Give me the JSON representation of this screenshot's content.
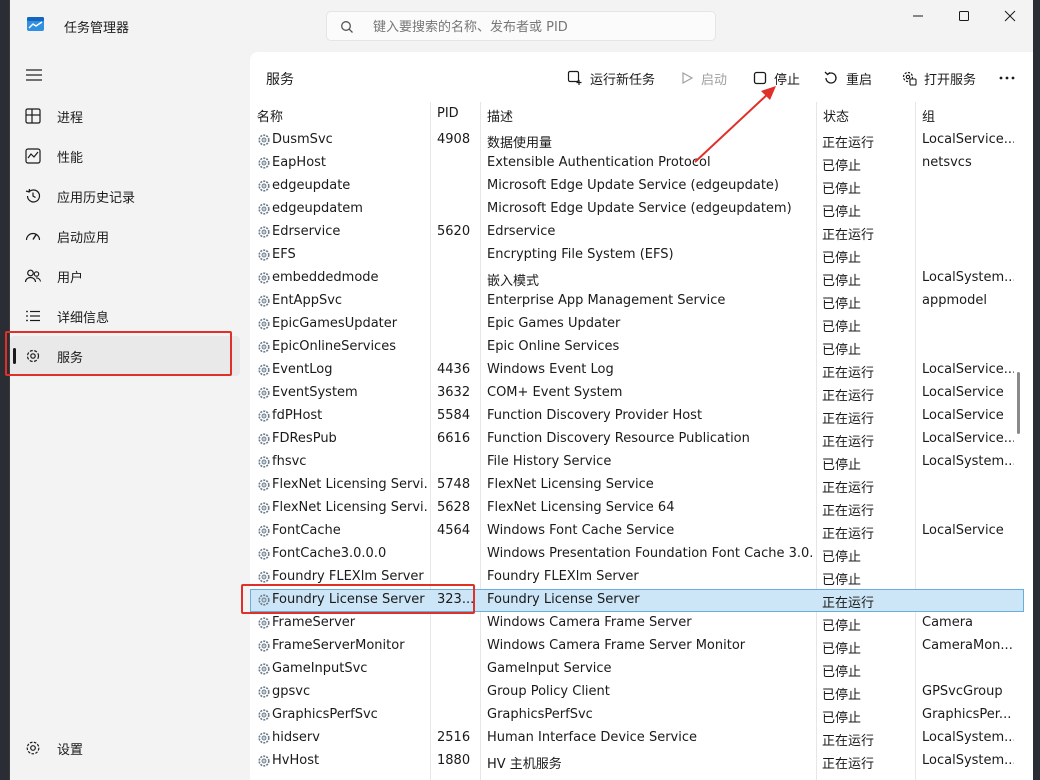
{
  "app": {
    "title": "任务管理器",
    "search_placeholder": "键入要搜索的名称、发布者或 PID"
  },
  "window_controls": {
    "minimize_icon": "minimize-icon",
    "maximize_icon": "maximize-icon",
    "close_icon": "close-icon"
  },
  "sidebar": {
    "items": [
      {
        "label": "进程",
        "icon": "processes-icon"
      },
      {
        "label": "性能",
        "icon": "performance-icon"
      },
      {
        "label": "应用历史记录",
        "icon": "history-icon"
      },
      {
        "label": "启动应用",
        "icon": "startup-icon"
      },
      {
        "label": "用户",
        "icon": "users-icon"
      },
      {
        "label": "详细信息",
        "icon": "details-icon"
      },
      {
        "label": "服务",
        "icon": "services-icon",
        "active": true
      }
    ],
    "settings_label": "设置"
  },
  "main": {
    "title": "服务",
    "toolbar": {
      "run_new_task": "运行新任务",
      "start": "启动",
      "stop": "停止",
      "restart": "重启",
      "open_services": "打开服务",
      "more_icon": "more-icon"
    }
  },
  "table": {
    "columns": [
      "名称",
      "PID",
      "描述",
      "状态",
      "组"
    ],
    "rows": [
      {
        "name": "DusmSvc",
        "pid": "4908",
        "desc": "数据使用量",
        "status": "正在运行",
        "group": "LocalService..."
      },
      {
        "name": "EapHost",
        "pid": "",
        "desc": "Extensible Authentication Protocol",
        "status": "已停止",
        "group": "netsvcs"
      },
      {
        "name": "edgeupdate",
        "pid": "",
        "desc": "Microsoft Edge Update Service (edgeupdate)",
        "status": "已停止",
        "group": ""
      },
      {
        "name": "edgeupdatem",
        "pid": "",
        "desc": "Microsoft Edge Update Service (edgeupdatem)",
        "status": "已停止",
        "group": ""
      },
      {
        "name": "Edrservice",
        "pid": "5620",
        "desc": "Edrservice",
        "status": "正在运行",
        "group": ""
      },
      {
        "name": "EFS",
        "pid": "",
        "desc": "Encrypting File System (EFS)",
        "status": "已停止",
        "group": ""
      },
      {
        "name": "embeddedmode",
        "pid": "",
        "desc": "嵌入模式",
        "status": "已停止",
        "group": "LocalSystem..."
      },
      {
        "name": "EntAppSvc",
        "pid": "",
        "desc": "Enterprise App Management Service",
        "status": "已停止",
        "group": "appmodel"
      },
      {
        "name": "EpicGamesUpdater",
        "pid": "",
        "desc": "Epic Games Updater",
        "status": "已停止",
        "group": ""
      },
      {
        "name": "EpicOnlineServices",
        "pid": "",
        "desc": "Epic Online Services",
        "status": "已停止",
        "group": ""
      },
      {
        "name": "EventLog",
        "pid": "4436",
        "desc": "Windows Event Log",
        "status": "正在运行",
        "group": "LocalService..."
      },
      {
        "name": "EventSystem",
        "pid": "3632",
        "desc": "COM+ Event System",
        "status": "正在运行",
        "group": "LocalService"
      },
      {
        "name": "fdPHost",
        "pid": "5584",
        "desc": "Function Discovery Provider Host",
        "status": "正在运行",
        "group": "LocalService"
      },
      {
        "name": "FDResPub",
        "pid": "6616",
        "desc": "Function Discovery Resource Publication",
        "status": "正在运行",
        "group": "LocalService..."
      },
      {
        "name": "fhsvc",
        "pid": "",
        "desc": "File History Service",
        "status": "已停止",
        "group": "LocalSystem..."
      },
      {
        "name": "FlexNet Licensing Servi...",
        "pid": "5748",
        "desc": "FlexNet Licensing Service",
        "status": "正在运行",
        "group": ""
      },
      {
        "name": "FlexNet Licensing Servi...",
        "pid": "5628",
        "desc": "FlexNet Licensing Service 64",
        "status": "正在运行",
        "group": ""
      },
      {
        "name": "FontCache",
        "pid": "4564",
        "desc": "Windows Font Cache Service",
        "status": "正在运行",
        "group": "LocalService"
      },
      {
        "name": "FontCache3.0.0.0",
        "pid": "",
        "desc": "Windows Presentation Foundation Font Cache 3.0....",
        "status": "已停止",
        "group": ""
      },
      {
        "name": "Foundry FLEXlm Server",
        "pid": "",
        "desc": "Foundry FLEXlm Server",
        "status": "已停止",
        "group": ""
      },
      {
        "name": "Foundry License Server",
        "pid": "323...",
        "desc": "Foundry License Server",
        "status": "正在运行",
        "group": "",
        "selected": true
      },
      {
        "name": "FrameServer",
        "pid": "",
        "desc": "Windows Camera Frame Server",
        "status": "已停止",
        "group": "Camera"
      },
      {
        "name": "FrameServerMonitor",
        "pid": "",
        "desc": "Windows Camera Frame Server Monitor",
        "status": "已停止",
        "group": "CameraMon..."
      },
      {
        "name": "GameInputSvc",
        "pid": "",
        "desc": "GameInput Service",
        "status": "已停止",
        "group": ""
      },
      {
        "name": "gpsvc",
        "pid": "",
        "desc": "Group Policy Client",
        "status": "已停止",
        "group": "GPSvcGroup"
      },
      {
        "name": "GraphicsPerfSvc",
        "pid": "",
        "desc": "GraphicsPerfSvc",
        "status": "已停止",
        "group": "GraphicsPer..."
      },
      {
        "name": "hidserv",
        "pid": "2516",
        "desc": "Human Interface Device Service",
        "status": "正在运行",
        "group": "LocalSystem..."
      },
      {
        "name": "HvHost",
        "pid": "1880",
        "desc": "HV 主机服务",
        "status": "正在运行",
        "group": "LocalSystem..."
      }
    ]
  },
  "colors": {
    "accent": "#0067c0",
    "selection": "#cde6f7",
    "annotation": "#e0302a"
  }
}
